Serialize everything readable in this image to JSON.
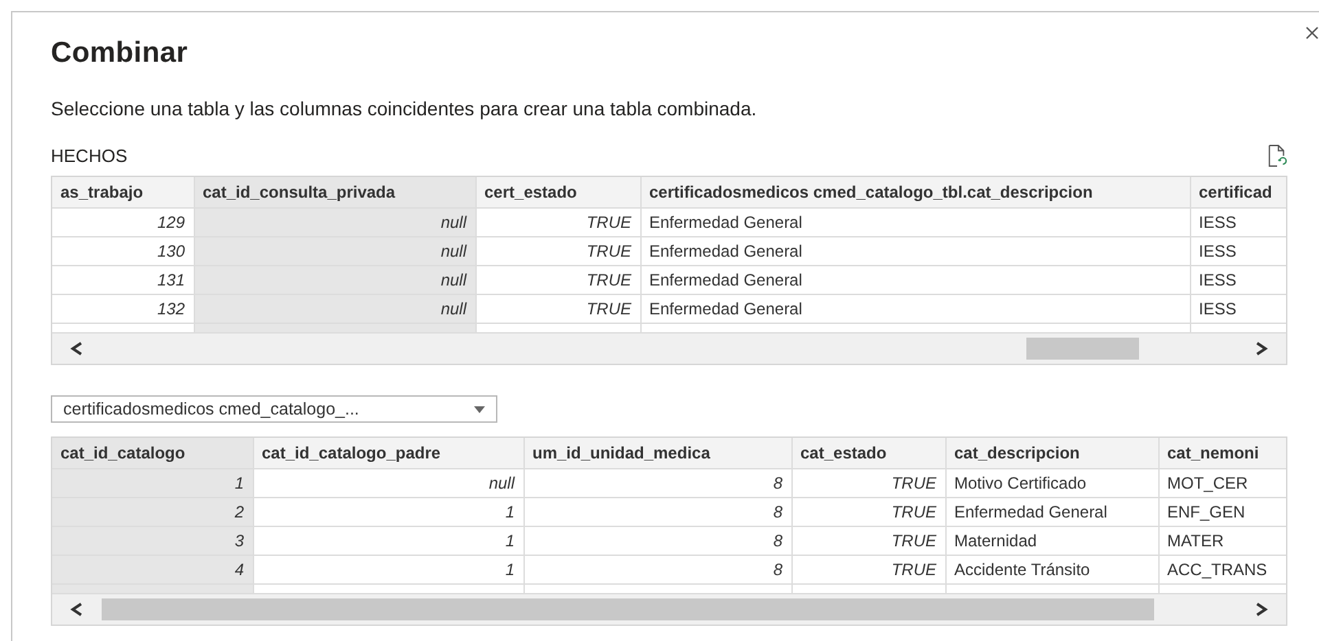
{
  "dialog": {
    "title": "Combinar",
    "description": "Seleccione una tabla y las columnas coincidentes para crear una tabla combinada."
  },
  "first_table": {
    "label": "HECHOS",
    "columns": [
      {
        "label": "as_trabajo",
        "kind": "value",
        "selected": false
      },
      {
        "label": "cat_id_consulta_privada",
        "kind": "value",
        "selected": true
      },
      {
        "label": "cert_estado",
        "kind": "value",
        "selected": false
      },
      {
        "label": "certificadosmedicos cmed_catalogo_tbl.cat_descripcion",
        "kind": "text",
        "selected": false
      },
      {
        "label": "certificad",
        "kind": "text",
        "selected": false
      }
    ],
    "rows": [
      [
        "129",
        "null",
        "TRUE",
        "Enfermedad General",
        "IESS"
      ],
      [
        "130",
        "null",
        "TRUE",
        "Enfermedad General",
        "IESS"
      ],
      [
        "131",
        "null",
        "TRUE",
        "Enfermedad General",
        "IESS"
      ],
      [
        "132",
        "null",
        "TRUE",
        "Enfermedad General",
        "IESS"
      ]
    ]
  },
  "second_table": {
    "table_select": "certificadosmedicos cmed_catalogo_...",
    "columns": [
      {
        "label": "cat_id_catalogo",
        "kind": "value",
        "selected": true
      },
      {
        "label": "cat_id_catalogo_padre",
        "kind": "value",
        "selected": false
      },
      {
        "label": "um_id_unidad_medica",
        "kind": "value",
        "selected": false
      },
      {
        "label": "cat_estado",
        "kind": "value",
        "selected": false
      },
      {
        "label": "cat_descripcion",
        "kind": "text",
        "selected": false
      },
      {
        "label": "cat_nemoni",
        "kind": "text",
        "selected": false
      }
    ],
    "rows": [
      [
        "1",
        "null",
        "8",
        "TRUE",
        "Motivo Certificado",
        "MOT_CER"
      ],
      [
        "2",
        "1",
        "8",
        "TRUE",
        "Enfermedad General",
        "ENF_GEN"
      ],
      [
        "3",
        "1",
        "8",
        "TRUE",
        "Maternidad",
        "MATER"
      ],
      [
        "4",
        "1",
        "8",
        "TRUE",
        "Accidente Tránsito",
        "ACC_TRANS"
      ]
    ]
  }
}
